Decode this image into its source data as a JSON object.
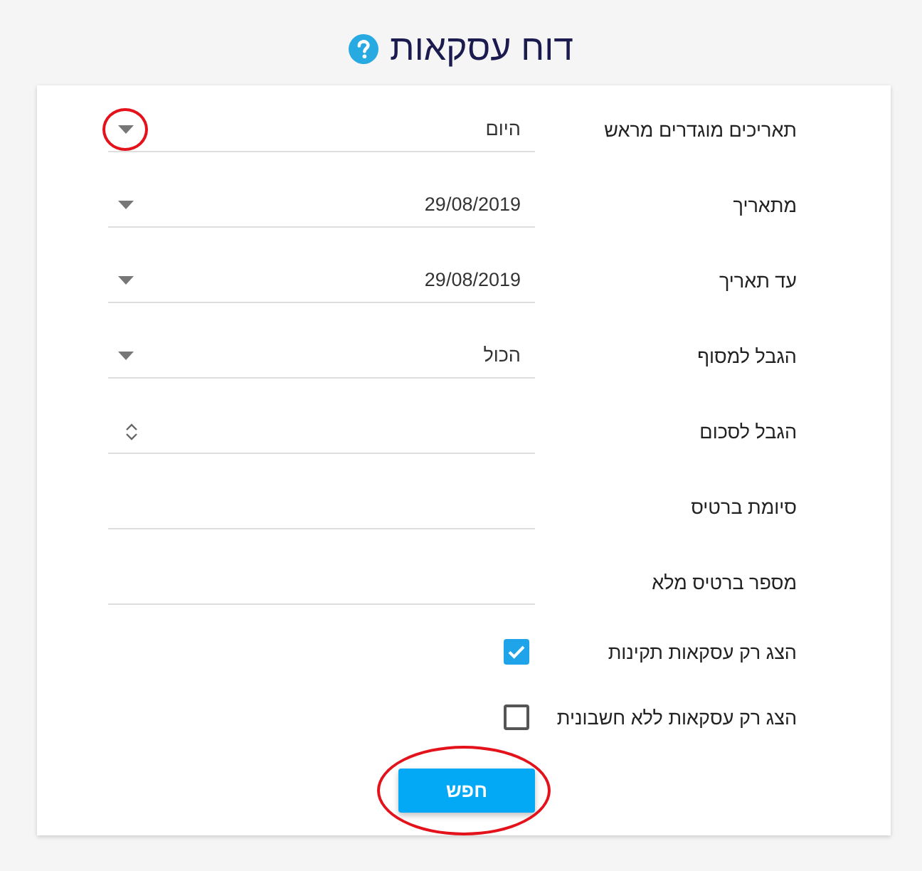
{
  "title": "דוח עסקאות",
  "fields": [
    {
      "kind": "select",
      "label": "תאריכים מוגדרים מראש",
      "value": "היום",
      "highlighted": true
    },
    {
      "kind": "select",
      "label": "מתאריך",
      "value": "29/08/2019",
      "highlighted": false
    },
    {
      "kind": "select",
      "label": "עד תאריך",
      "value": "29/08/2019",
      "highlighted": false
    },
    {
      "kind": "select",
      "label": "הגבל למסוף",
      "value": "הכול",
      "highlighted": false
    },
    {
      "kind": "number",
      "label": "הגבל לסכום",
      "highlighted": false
    },
    {
      "kind": "text",
      "label": "סיומת ברטיס",
      "highlighted": false
    },
    {
      "kind": "text",
      "label": "מספר ברטיס מלא",
      "highlighted": false
    }
  ],
  "checkboxes": [
    {
      "label": "הצג רק עסקאות תקינות",
      "checked": true
    },
    {
      "label": "הצג רק עסקאות ללא חשבונית",
      "checked": false
    }
  ],
  "button": {
    "label": "חפש",
    "highlighted": true
  }
}
